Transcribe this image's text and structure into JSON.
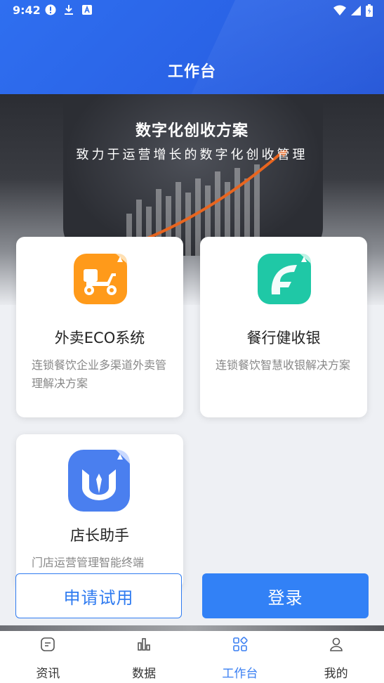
{
  "status_bar": {
    "time": "9:42",
    "left_icons": [
      "alert-icon",
      "download-icon",
      "app-a-icon"
    ],
    "right_icons": [
      "wifi-icon",
      "signal-icon",
      "battery-icon"
    ]
  },
  "header": {
    "title": "工作台"
  },
  "banner": {
    "title": "数字化创收方案",
    "subtitle": "致力于运营增长的数字化创收管理"
  },
  "cards": [
    {
      "title": "外卖ECO系统",
      "desc": "连锁餐饮企业多渠道外卖管理解决方案",
      "icon": "delivery-scooter-icon",
      "color": "#ff9a1a"
    },
    {
      "title": "餐行健收银",
      "desc": "连锁餐饮智慧收银解决方案",
      "icon": "cashier-f-icon",
      "color": "#1fc8a6"
    },
    {
      "title": "店长助手",
      "desc": "门店运营管理智能终端",
      "icon": "manager-assistant-icon",
      "color": "#4a7fef"
    }
  ],
  "actions": {
    "trial_label": "申请试用",
    "login_label": "登录"
  },
  "bottom_nav": [
    {
      "label": "资讯",
      "icon": "news-icon",
      "active": false
    },
    {
      "label": "数据",
      "icon": "chart-icon",
      "active": false
    },
    {
      "label": "工作台",
      "icon": "workbench-icon",
      "active": true
    },
    {
      "label": "我的",
      "icon": "profile-icon",
      "active": false
    }
  ],
  "colors": {
    "primary": "#3281f6",
    "header": "#2f6ff0",
    "active_nav": "#3a7ff2"
  }
}
